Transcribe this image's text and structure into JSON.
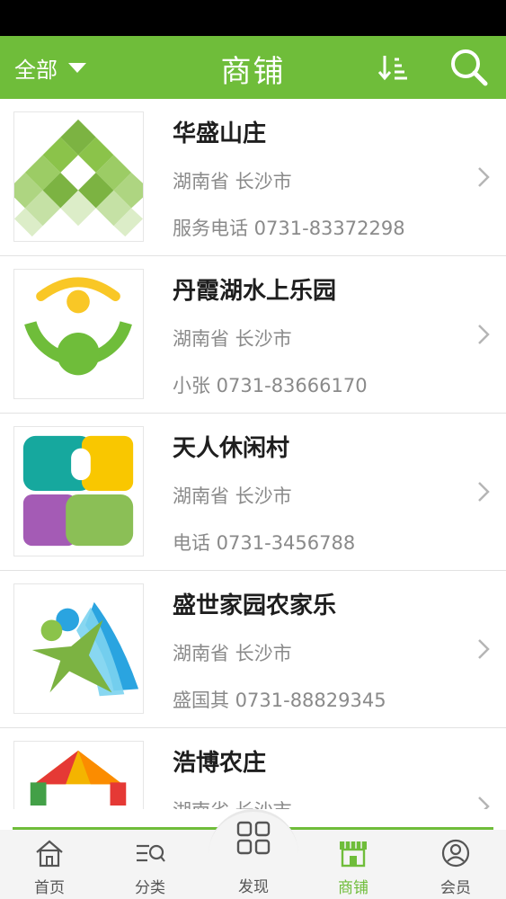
{
  "header": {
    "filter_label": "全部",
    "title": "商铺",
    "sort_icon": "sort-icon",
    "search_icon": "search-icon",
    "accent_color": "#6fbd3a"
  },
  "shops": [
    {
      "name": "华盛山庄",
      "location": "湖南省 长沙市",
      "phone": "服务电话 0731-83372298",
      "logo": "green-diamond-logo"
    },
    {
      "name": "丹霞湖水上乐园",
      "location": "湖南省 长沙市",
      "phone": "小张 0731-83666170",
      "logo": "green-person-logo"
    },
    {
      "name": "天人休闲村",
      "location": "湖南省 长沙市",
      "phone": "电话 0731-3456788",
      "logo": "four-color-blocks-logo"
    },
    {
      "name": "盛世家园农家乐",
      "location": "湖南省 长沙市",
      "phone": "盛国其 0731-88829345",
      "logo": "leaping-figure-logo"
    },
    {
      "name": "浩博农庄",
      "location": "湖南省 长沙市",
      "phone": "",
      "logo": "rainbow-arch-logo"
    }
  ],
  "tabbar": {
    "tabs": [
      {
        "label": "首页",
        "icon": "home-icon"
      },
      {
        "label": "分类",
        "icon": "category-icon"
      },
      {
        "label": "发现",
        "icon": "discover-grid-icon"
      },
      {
        "label": "商铺",
        "icon": "shop-icon",
        "active": true
      },
      {
        "label": "会员",
        "icon": "member-icon"
      }
    ]
  }
}
